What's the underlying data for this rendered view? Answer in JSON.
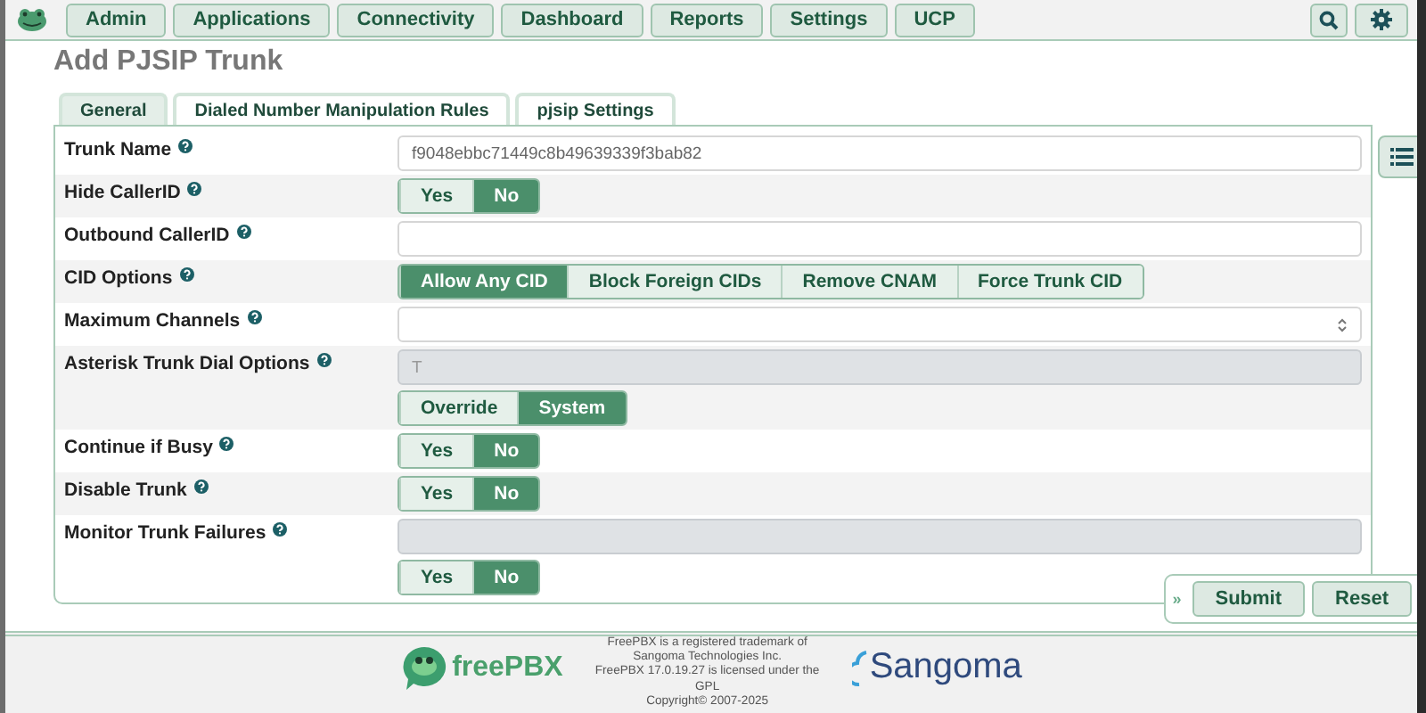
{
  "nav": {
    "items": [
      "Admin",
      "Applications",
      "Connectivity",
      "Dashboard",
      "Reports",
      "Settings",
      "UCP"
    ]
  },
  "title": "Add PJSIP Trunk",
  "tabs": [
    {
      "label": "General",
      "selected": true
    },
    {
      "label": "Dialed Number Manipulation Rules",
      "selected": false
    },
    {
      "label": "pjsip Settings",
      "selected": false
    }
  ],
  "form": {
    "rows": [
      {
        "label": "Trunk Name",
        "kind": "text",
        "value": "f9048ebbc71449c8b49639339f3bab82",
        "disabled": false
      },
      {
        "label": "Hide CallerID",
        "kind": "toggle",
        "options": [
          {
            "label": "Yes",
            "selected": false
          },
          {
            "label": "No",
            "selected": true
          }
        ]
      },
      {
        "label": "Outbound CallerID",
        "kind": "text",
        "disabled": false
      },
      {
        "label": "CID Options",
        "kind": "toggle",
        "options": [
          {
            "label": "Allow Any CID",
            "selected": true
          },
          {
            "label": "Block Foreign CIDs",
            "selected": false
          },
          {
            "label": "Remove CNAM",
            "selected": false
          },
          {
            "label": "Force Trunk CID",
            "selected": false
          }
        ]
      },
      {
        "label": "Maximum Channels",
        "kind": "number",
        "disabled": false
      },
      {
        "label": "Asterisk Trunk Dial Options",
        "kind": "text_toggle",
        "value": "T",
        "disabled": true,
        "options": [
          {
            "label": "Override",
            "selected": false
          },
          {
            "label": "System",
            "selected": true
          }
        ]
      },
      {
        "label": "Continue if Busy",
        "kind": "toggle",
        "options": [
          {
            "label": "Yes",
            "selected": false
          },
          {
            "label": "No",
            "selected": true
          }
        ]
      },
      {
        "label": "Disable Trunk",
        "kind": "toggle",
        "options": [
          {
            "label": "Yes",
            "selected": false
          },
          {
            "label": "No",
            "selected": true
          }
        ]
      },
      {
        "label": "Monitor Trunk Failures",
        "kind": "text_toggle",
        "disabled": true,
        "options": [
          {
            "label": "Yes",
            "selected": false
          },
          {
            "label": "No",
            "selected": true
          }
        ]
      }
    ]
  },
  "actions": {
    "expander": "»",
    "buttons": [
      "Submit",
      "Reset"
    ]
  },
  "footer": {
    "brand": "freePBX",
    "company": "Sangoma",
    "lines": [
      "FreePBX is a registered trademark of",
      "Sangoma Technologies Inc.",
      "FreePBX 17.0.19.27 is licensed under the",
      "GPL",
      "Copyright© 2007-2025"
    ]
  }
}
